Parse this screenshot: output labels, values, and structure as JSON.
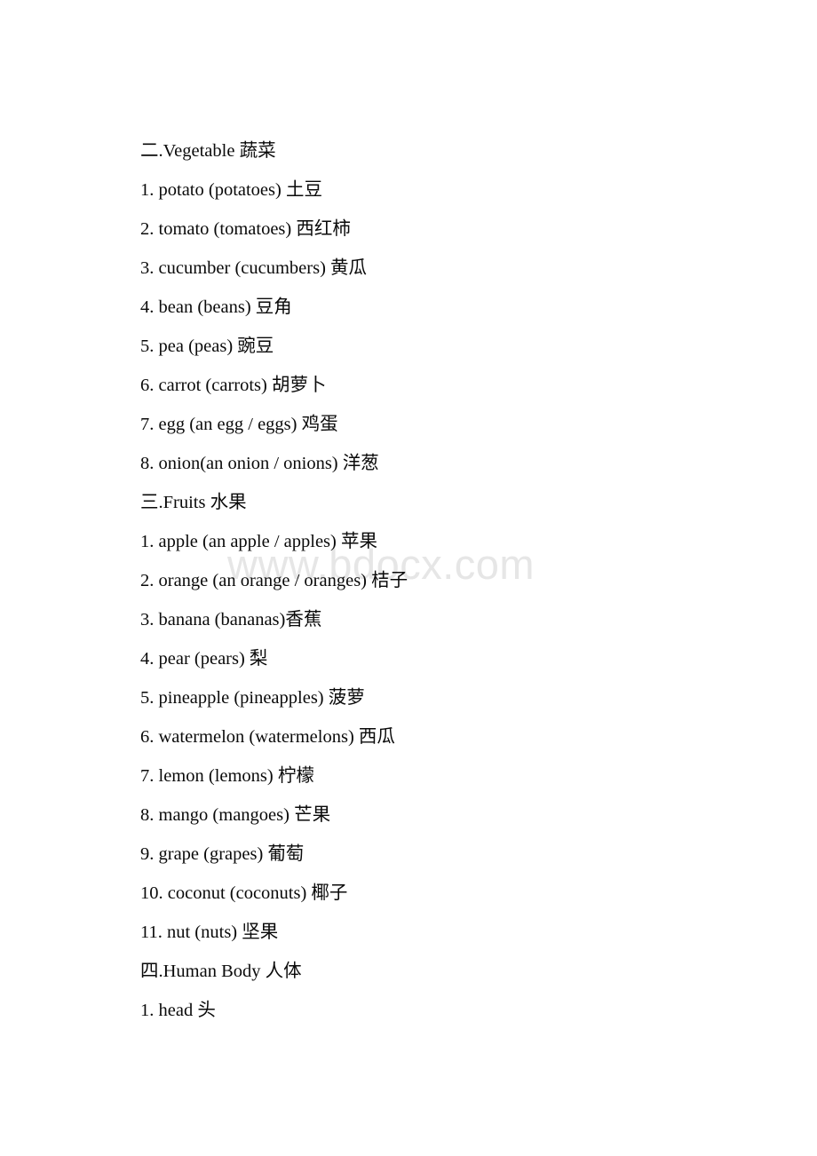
{
  "document": {
    "background_color": "#ffffff",
    "text_color": "#0a0a0a",
    "watermark": {
      "text": "www.bdocx.com",
      "color": "#e6e6e6"
    },
    "lines": [
      {
        "kind": "heading",
        "text": "二.Vegetable 蔬菜"
      },
      {
        "kind": "item",
        "text": "1. potato (potatoes) 土豆"
      },
      {
        "kind": "item",
        "text": "2. tomato (tomatoes) 西红柿"
      },
      {
        "kind": "item",
        "text": "3. cucumber (cucumbers) 黄瓜"
      },
      {
        "kind": "item",
        "text": "4. bean (beans) 豆角"
      },
      {
        "kind": "item",
        "text": "5. pea (peas) 豌豆"
      },
      {
        "kind": "item",
        "text": "6. carrot (carrots) 胡萝卜"
      },
      {
        "kind": "item",
        "text": "7. egg (an egg / eggs) 鸡蛋"
      },
      {
        "kind": "item",
        "text": "8. onion(an onion / onions) 洋葱"
      },
      {
        "kind": "heading",
        "text": "三.Fruits 水果"
      },
      {
        "kind": "item",
        "text": "1. apple (an apple / apples) 苹果"
      },
      {
        "kind": "item",
        "text": "2. orange (an orange / oranges) 桔子"
      },
      {
        "kind": "item",
        "text": "3. banana (bananas)香蕉"
      },
      {
        "kind": "item",
        "text": "4. pear (pears) 梨"
      },
      {
        "kind": "item",
        "text": "5. pineapple (pineapples) 菠萝"
      },
      {
        "kind": "item",
        "text": "6. watermelon (watermelons) 西瓜"
      },
      {
        "kind": "item",
        "text": "7. lemon (lemons) 柠檬"
      },
      {
        "kind": "item",
        "text": "8. mango (mangoes) 芒果"
      },
      {
        "kind": "item",
        "text": "9. grape (grapes) 葡萄"
      },
      {
        "kind": "item",
        "text": "10. coconut (coconuts) 椰子"
      },
      {
        "kind": "item",
        "text": "11. nut (nuts) 坚果"
      },
      {
        "kind": "heading",
        "text": "四.Human Body 人体"
      },
      {
        "kind": "item",
        "text": "1. head 头"
      }
    ]
  }
}
